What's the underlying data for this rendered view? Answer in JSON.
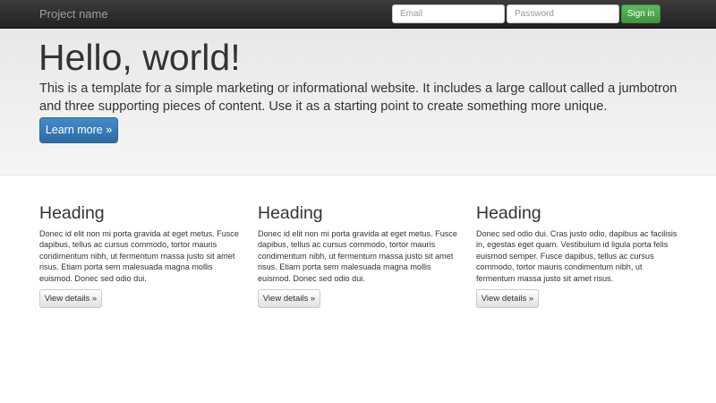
{
  "navbar": {
    "brand": "Project name",
    "email_placeholder": "Email",
    "password_placeholder": "Password",
    "signin_label": "Sign in",
    "colors": {
      "background": "#222222",
      "brand_text": "#9d9d9d",
      "signin": "#5cb85c"
    }
  },
  "jumbotron": {
    "title": "Hello, world!",
    "lead": "This is a template for a simple marketing or informational website. It includes a large callout called a jumbotron and three supporting pieces of content. Use it as a starting point to create something more unique.",
    "button_label": "Learn more »",
    "colors": {
      "background": "#eeeeee",
      "button": "#428bca"
    }
  },
  "columns": [
    {
      "heading": "Heading",
      "text": "Donec id elit non mi porta gravida at eget metus. Fusce dapibus, tellus ac cursus commodo, tortor mauris condimentum nibh, ut fermentum massa justo sit amet risus. Etiam porta sem malesuada magna mollis euismod. Donec sed odio dui.",
      "button_label": "View details »"
    },
    {
      "heading": "Heading",
      "text": "Donec id elit non mi porta gravida at eget metus. Fusce dapibus, tellus ac cursus commodo, tortor mauris condimentum nibh, ut fermentum massa justo sit amet risus. Etiam porta sem malesuada magna mollis euismod. Donec sed odio dui.",
      "button_label": "View details »"
    },
    {
      "heading": "Heading",
      "text": "Donec sed odio dui. Cras justo odio, dapibus ac facilisis in, egestas eget quam. Vestibulum id ligula porta felis euismod semper. Fusce dapibus, tellus ac cursus commodo, tortor mauris condimentum nibh, ut fermentum massa justo sit amet risus.",
      "button_label": "View details »"
    }
  ]
}
